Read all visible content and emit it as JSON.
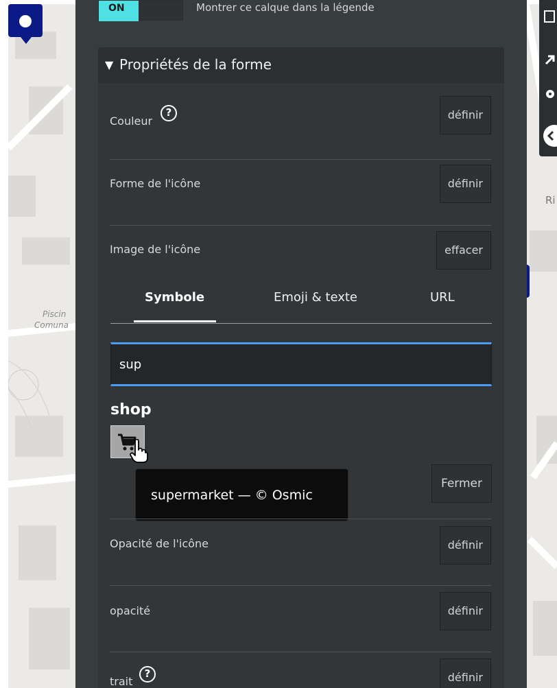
{
  "layer": {
    "toggle_label": "ON",
    "show_in_legend_label": "Montrer ce calque dans la légende"
  },
  "map": {
    "labels": [
      "Piscin",
      "Comuna",
      "Ri"
    ]
  },
  "shape_properties": {
    "title": "Propriétés de la forme",
    "caret_icon": "caret-down-icon",
    "rows": [
      {
        "label": "Couleur",
        "button": "définir",
        "has_help": true
      },
      {
        "label": "Forme de l'icône",
        "button": "définir",
        "has_help": false
      },
      {
        "label": "Image de l'icône",
        "button": "effacer",
        "has_help": false
      },
      {
        "label": "Opacité de l'icône",
        "button": "définir",
        "has_help": false
      },
      {
        "label": "opacité",
        "button": "définir",
        "has_help": false
      },
      {
        "label": "trait",
        "button": "définir",
        "has_help": true
      }
    ],
    "help_glyph": "?"
  },
  "icon_picker": {
    "tabs": [
      {
        "label": "Symbole",
        "active": true
      },
      {
        "label": "Emoji & texte",
        "active": false
      },
      {
        "label": "URL",
        "active": false
      }
    ],
    "search_value": "sup",
    "results_group": "shop",
    "result_icon": "cart-icon",
    "tooltip": "supermarket — © Osmic",
    "close_button": "Fermer"
  },
  "colors": {
    "accent_toggle": "#4ee0e3",
    "focus_border": "#4a9cf5",
    "marker": "#0b1a86",
    "panel_bg": "#373c3e"
  }
}
